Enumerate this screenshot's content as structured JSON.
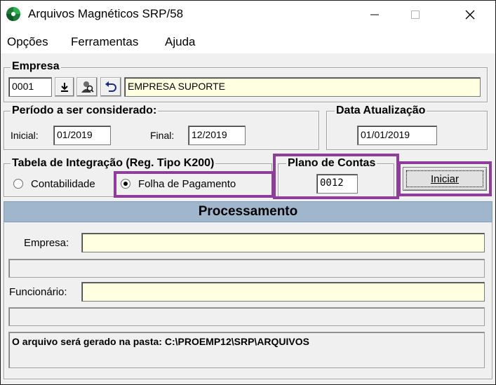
{
  "window": {
    "title": "Arquivos Magnéticos SRP/58",
    "minimize_glyph": "—",
    "maximize_glyph": "☐",
    "close_glyph": "✕"
  },
  "menu": {
    "items": [
      {
        "label": "Opções"
      },
      {
        "label": "Ferramentas"
      },
      {
        "label": "Ajuda"
      }
    ]
  },
  "empresa": {
    "group_label": "Empresa",
    "code": "0001",
    "name": "EMPRESA SUPORTE",
    "icons": [
      "download-icon",
      "user-search-icon",
      "undo-icon"
    ]
  },
  "periodo": {
    "group_label": "Período a ser considerado:",
    "inicial_label": "Inicial:",
    "inicial_value": "01/2019",
    "final_label": "Final:",
    "final_value": "12/2019"
  },
  "data_atualizacao": {
    "group_label": "Data Atualização",
    "value": "01/01/2019"
  },
  "tabela": {
    "group_label": "Tabela de Integração (Reg. Tipo K200)",
    "options": [
      {
        "label": "Contabilidade",
        "checked": false
      },
      {
        "label": "Folha de Pagamento",
        "checked": true
      }
    ]
  },
  "plano": {
    "group_label": "Plano de Contas",
    "value": "0012"
  },
  "actions": {
    "iniciar_label": "Iniciar"
  },
  "processamento": {
    "header": "Processamento",
    "empresa_label": "Empresa:",
    "empresa_value": "",
    "funcionario_label": "Funcionário:",
    "funcionario_value": "",
    "info": "O arquivo será gerado na pasta: C:\\PROEMP12\\SRP\\ARQUIVOS"
  },
  "colors": {
    "highlight": "#8e3e9a",
    "header_bg": "#9fb6cd",
    "field_yellow": "#ffffe1"
  }
}
